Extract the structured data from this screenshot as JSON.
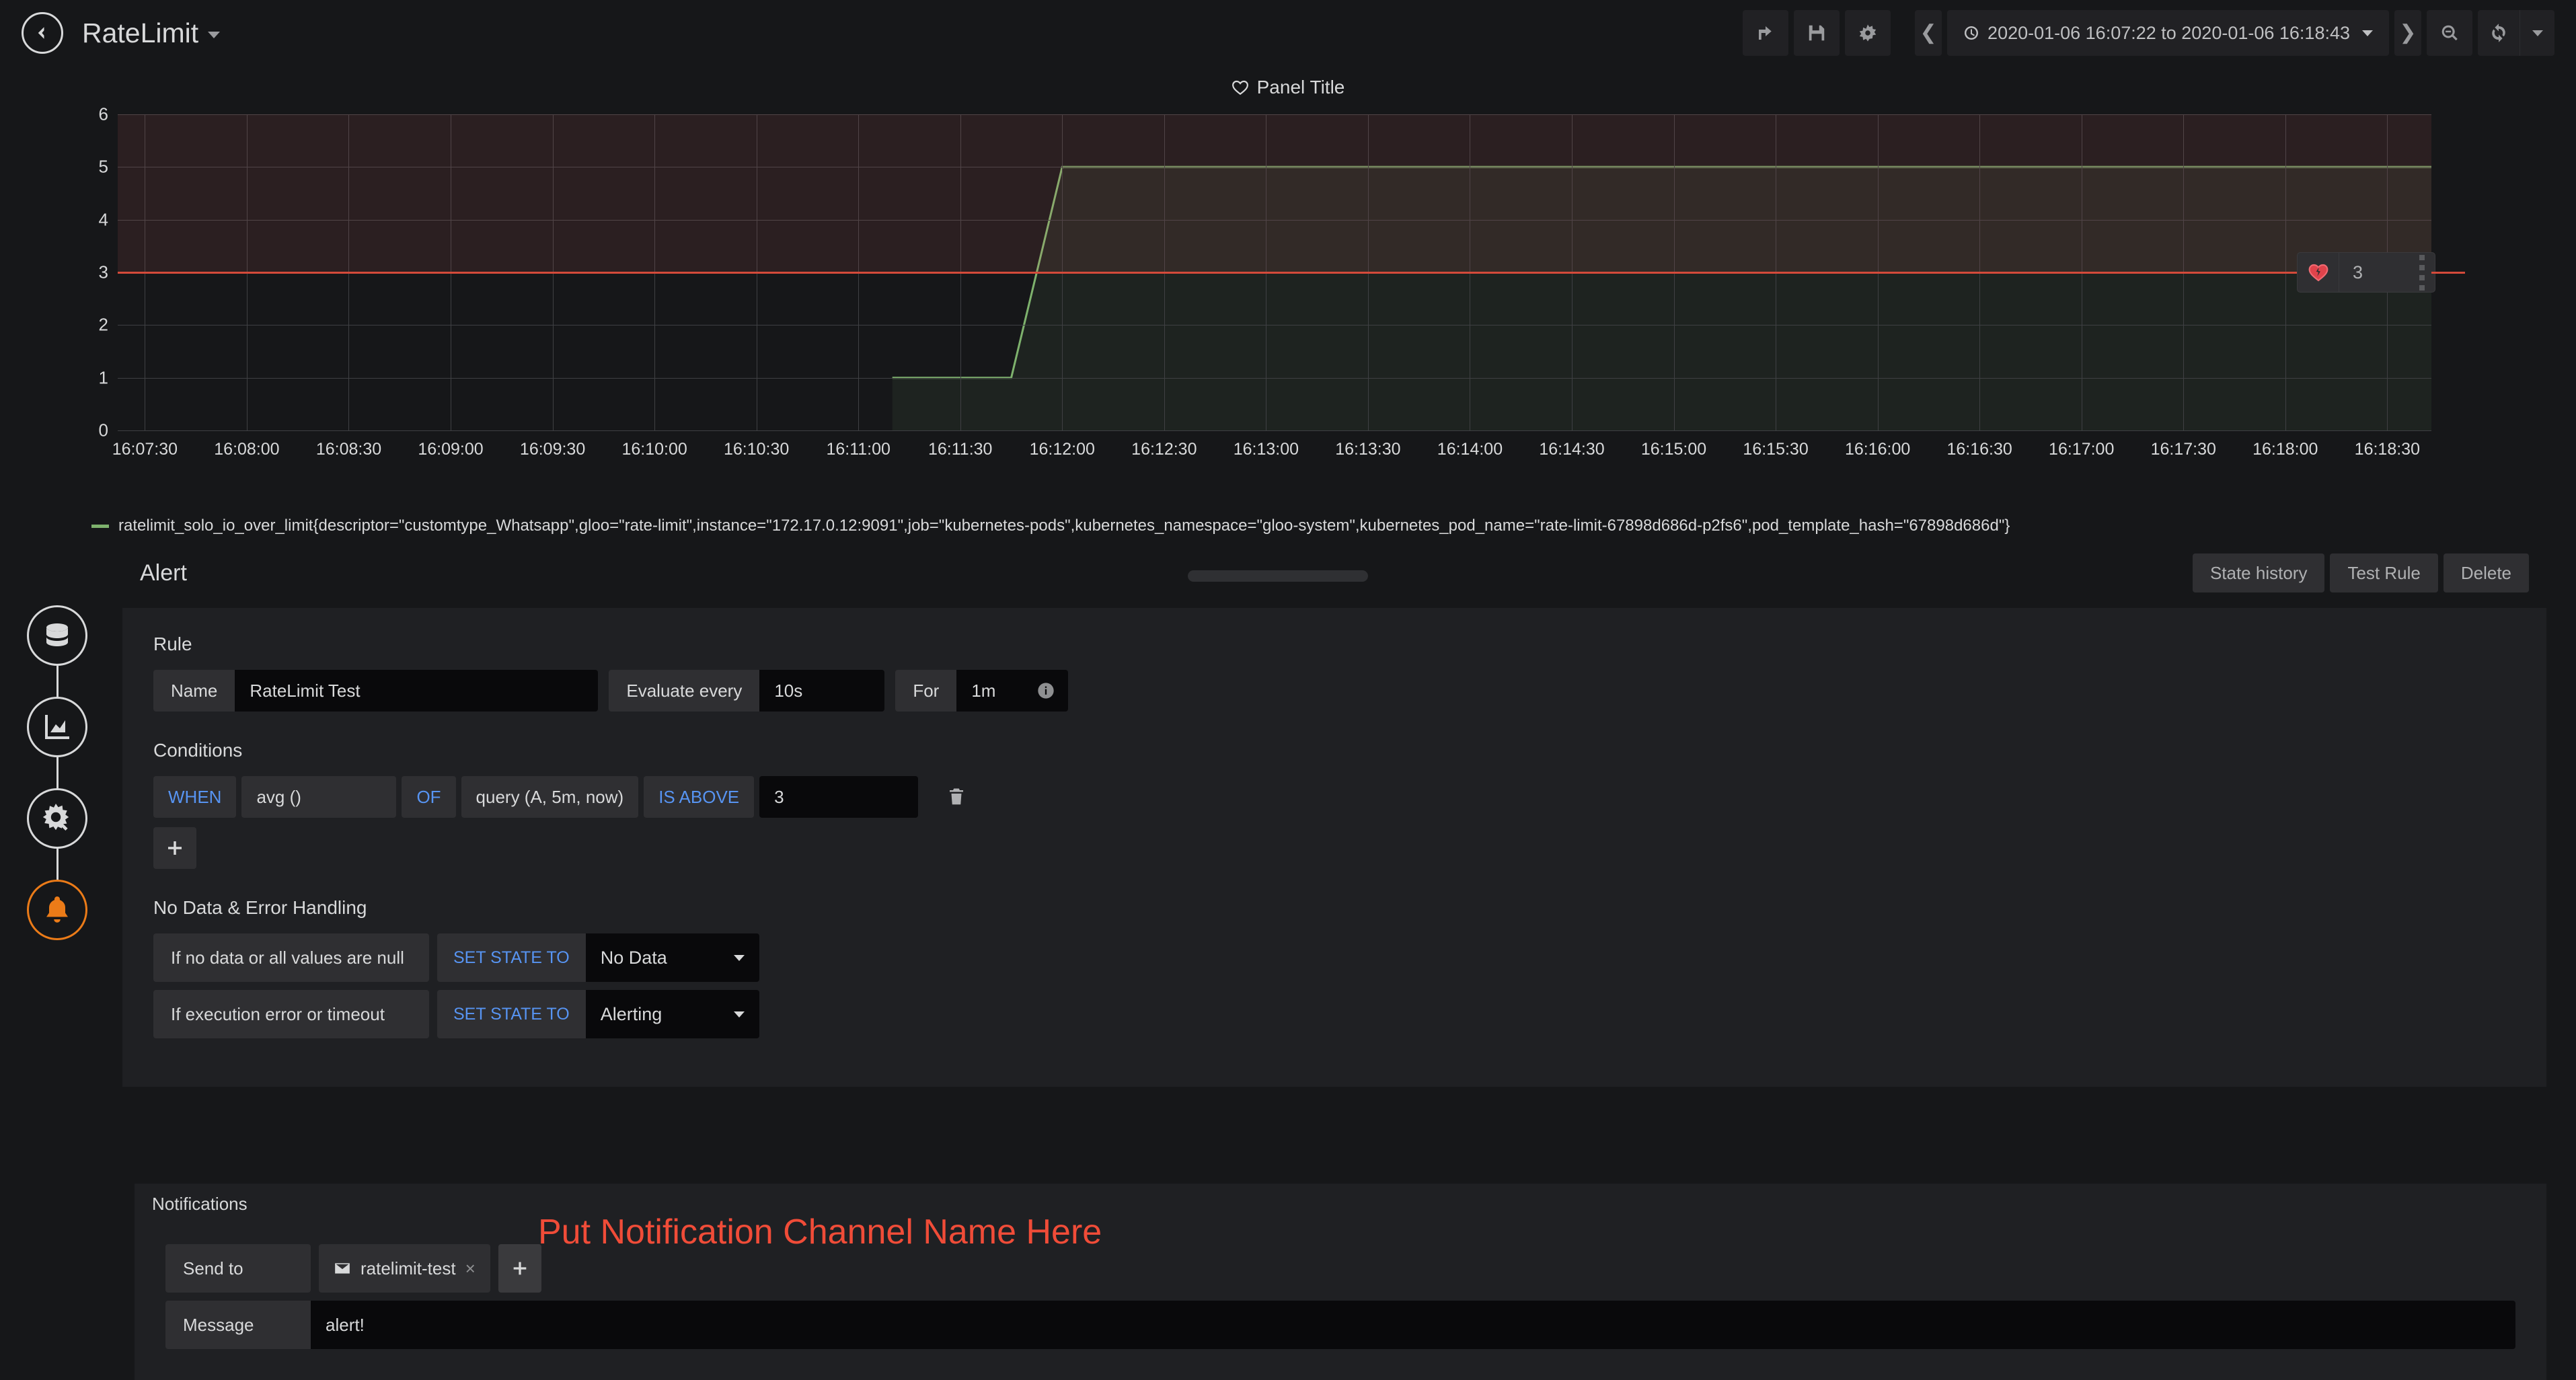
{
  "topnav": {
    "back_icon": "arrow-left-circle-icon",
    "dashboard_title": "RateLimit",
    "dropdown_icon": "chevron-down-icon",
    "share_icon": "share-icon",
    "save_icon": "save-icon",
    "settings_icon": "gear-icon",
    "time_prev_icon": "chevron-left-icon",
    "time_next_icon": "chevron-right-icon",
    "clock_icon": "clock-icon",
    "time_range": "2020-01-06 16:07:22 to 2020-01-06 16:18:43",
    "zoom_out_icon": "zoom-out-icon",
    "refresh_icon": "refresh-icon",
    "refresh_caret_icon": "chevron-down-icon"
  },
  "panel": {
    "title": "Panel Title",
    "title_icon": "heart-icon",
    "legend": "ratelimit_solo_io_over_limit{descriptor=\"customtype_Whatsapp\",gloo=\"rate-limit\",instance=\"172.17.0.12:9091\",job=\"kubernetes-pods\",kubernetes_namespace=\"gloo-system\",kubernetes_pod_name=\"rate-limit-67898d686d-p2fs6\",pod_template_hash=\"67898d686d\"}",
    "legend_color": "#7eb26d",
    "threshold_handle": {
      "icon": "heart-break-icon",
      "value": "3",
      "grip_icon": "drag-grip-icon"
    }
  },
  "chart_data": {
    "type": "line",
    "title": "Panel Title",
    "xlabel": "",
    "ylabel": "",
    "ylim": [
      0,
      6
    ],
    "yticks": [
      0,
      1,
      2,
      3,
      4,
      5,
      6
    ],
    "xlim": [
      "16:07:22",
      "16:18:43"
    ],
    "xticks": [
      "16:07:30",
      "16:08:00",
      "16:08:30",
      "16:09:00",
      "16:09:30",
      "16:10:00",
      "16:10:30",
      "16:11:00",
      "16:11:30",
      "16:12:00",
      "16:12:30",
      "16:13:00",
      "16:13:30",
      "16:14:00",
      "16:14:30",
      "16:15:00",
      "16:15:30",
      "16:16:00",
      "16:16:30",
      "16:17:00",
      "16:17:30",
      "16:18:00",
      "16:18:30"
    ],
    "grid": true,
    "legend_position": "bottom",
    "series": [
      {
        "name": "ratelimit_solo_io_over_limit{descriptor=\"customtype_Whatsapp\",gloo=\"rate-limit\",instance=\"172.17.0.12:9091\",job=\"kubernetes-pods\",kubernetes_namespace=\"gloo-system\",kubernetes_pod_name=\"rate-limit-67898d686d-p2fs6\",pod_template_hash=\"67898d686d\"}",
        "color": "#7eb26d",
        "x": [
          "16:11:10",
          "16:11:45",
          "16:12:00",
          "16:18:43"
        ],
        "values": [
          1,
          1,
          5,
          5
        ]
      }
    ],
    "threshold": {
      "value": 3,
      "op": "gt",
      "line_color": "#d44a3a",
      "fill_color": "rgba(234,112,112,0.10)"
    }
  },
  "stepper": [
    {
      "name": "queries-step",
      "icon": "database-icon",
      "active": false
    },
    {
      "name": "visualization-step",
      "icon": "graph-area-icon",
      "active": false
    },
    {
      "name": "general-step",
      "icon": "gear-wrench-icon",
      "active": false
    },
    {
      "name": "alert-step",
      "icon": "bell-icon",
      "active": true
    }
  ],
  "alert": {
    "heading": "Alert",
    "buttons": {
      "state_history": "State history",
      "test_rule": "Test Rule",
      "delete": "Delete"
    },
    "rule": {
      "section": "Rule",
      "name_label": "Name",
      "name_value": "RateLimit Test",
      "evaluate_label": "Evaluate every",
      "evaluate_value": "10s",
      "for_label": "For",
      "for_value": "1m",
      "info_icon": "info-icon"
    },
    "conditions": {
      "section": "Conditions",
      "rows": [
        {
          "when": "WHEN",
          "reducer": "avg ()",
          "of": "OF",
          "query": "query (A, 5m, now)",
          "evaluator": "IS ABOVE",
          "threshold": "3",
          "delete_icon": "trash-icon"
        }
      ],
      "add_icon": "plus-icon"
    },
    "handling": {
      "section": "No Data & Error Handling",
      "rows": [
        {
          "label": "If no data or all values are null",
          "keyword": "SET STATE TO",
          "value": "No Data",
          "caret": "chevron-down-icon"
        },
        {
          "label": "If execution error or timeout",
          "keyword": "SET STATE TO",
          "value": "Alerting",
          "caret": "chevron-down-icon"
        }
      ]
    },
    "notifications": {
      "section": "Notifications",
      "annotation": "Put Notification Channel Name Here",
      "annotation_color": "#f04c38",
      "send_to_label": "Send to",
      "channels": [
        {
          "name": "ratelimit-test",
          "icon": "mail-icon",
          "remove": "×"
        }
      ],
      "add_icon": "plus-icon",
      "message_label": "Message",
      "message_value": "alert!"
    }
  }
}
